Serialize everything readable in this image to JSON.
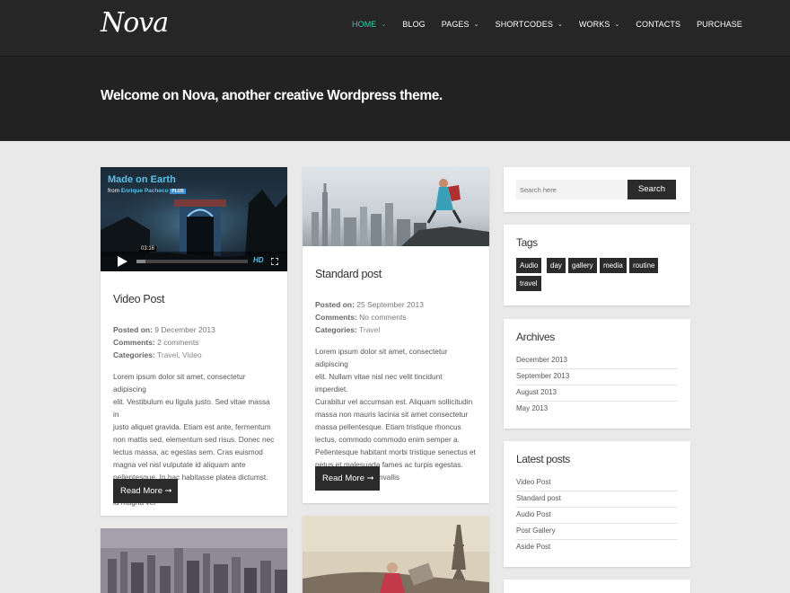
{
  "brand": {
    "logo": "Nova"
  },
  "nav": {
    "items": [
      {
        "label": "HOME",
        "dropdown": true,
        "active": true
      },
      {
        "label": "BLOG",
        "dropdown": false
      },
      {
        "label": "PAGES",
        "dropdown": true
      },
      {
        "label": "SHORTCODES",
        "dropdown": true
      },
      {
        "label": "WORKS",
        "dropdown": true
      },
      {
        "label": "CONTACTS",
        "dropdown": false
      },
      {
        "label": "PURCHASE",
        "dropdown": false
      }
    ],
    "chevron": "⌄"
  },
  "hero": {
    "title": "Welcome on Nova, another creative Wordpress theme."
  },
  "posts": [
    {
      "title": "Video Post",
      "video": {
        "title": "Made on Earth",
        "by": "from",
        "author": "Enrique Pacheco",
        "badge": "PLUS",
        "time": "03:16",
        "hd": "HD"
      },
      "meta": {
        "posted_label": "Posted on:",
        "posted_value": "9 December 2013",
        "comments_label": "Comments:",
        "comments_value": "2 comments",
        "categories_label": "Categories:",
        "cat1": "Travel",
        "sep": ", ",
        "cat2": "Video"
      },
      "excerpt": [
        "Lorem ipsum dolor sit amet, consectetur adipiscing",
        "elit. Vestibulum eu ligula justo. Sed vitae massa in",
        "justo aliquet gravida. Etiam est ante, fermentum",
        "non mattis sed, elementum sed risus. Donec nec",
        "lectus massa, ac egestas sem. Cras euismod",
        "magna vel nisl vulputate id aliquam ante",
        "pellentesque. In hac habitasse platea dictumst. In",
        "id magna vel"
      ],
      "read_more": "Read More ➞"
    },
    {
      "title": "Standard post",
      "meta": {
        "posted_label": "Posted on:",
        "posted_value": "25 September 2013",
        "comments_label": "Comments:",
        "comments_value": "No comments",
        "categories_label": "Categories:",
        "cat1": "Travel"
      },
      "excerpt": [
        "Lorem ipsum dolor sit amet, consectetur adipiscing",
        "elit. Nullam vitae nisl nec velit tincidunt imperdiet.",
        "Curabitur vel accumsan est. Aliquam sollicitudin",
        "massa non mauris lacinia sit amet consectetur",
        "massa pellentesque. Etiam tristique rhoncus",
        "lectus, commodo commodo enim semper a.",
        "Pellentesque habitant morbi tristique senectus et",
        "netus et malesuada fames ac turpis egestas.",
        "Praesent cursus convallis"
      ],
      "read_more": "Read More ➞"
    }
  ],
  "sidebar": {
    "search": {
      "placeholder": "Search here",
      "button": "Search"
    },
    "tags": {
      "title": "Tags",
      "items": [
        "Audio",
        "day",
        "gallery",
        "media",
        "routine",
        "travel"
      ]
    },
    "archives": {
      "title": "Archives",
      "items": [
        "December 2013",
        "September 2013",
        "August 2013",
        "May 2013"
      ]
    },
    "latest": {
      "title": "Latest posts",
      "items": [
        "Video Post",
        "Standard post",
        "Audio Post",
        "Post Gallery",
        "Aside Post"
      ]
    }
  },
  "colors": {
    "accent": "#36c6a8",
    "header_bg": "#262626",
    "hero_bg": "#222222",
    "page_bg": "#e9e9e9",
    "button_bg": "#2b2b2b"
  }
}
